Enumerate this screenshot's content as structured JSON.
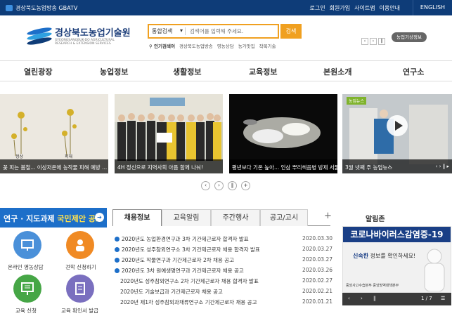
{
  "topbar": {
    "tv_label": "경상북도농업방송 GBATV",
    "links": [
      "로그인",
      "회원가입",
      "사이트맵",
      "이용안내"
    ],
    "lang": "ENGLISH"
  },
  "logo": {
    "name": "경상북도농업기술원",
    "sub_line1": "GYEONGSANGBUK-DO AGRICULTURAL",
    "sub_line2": "RESEARCH & EXTENSION SERVICES"
  },
  "search": {
    "scope": "통합검색",
    "placeholder": "검색어를 입력해 주세요.",
    "button": "검색"
  },
  "popular": {
    "label": "인기검색어",
    "terms": [
      "경상북도농업방송",
      "영농상담",
      "농가맛집",
      "작목기술"
    ]
  },
  "weather_button": "농업기상정보",
  "gnb": [
    "열린광장",
    "농업정보",
    "생활정보",
    "교육정보",
    "본원소개",
    "연구소"
  ],
  "slides": [
    {
      "caption": "꽃 피는 봄철... 이상저온에 농작물 피해 예방 ...",
      "art": "정상",
      "art2": "피해"
    },
    {
      "caption": "4H 정신으로 지역사회 아픔 함께 나눠!"
    },
    {
      "caption": "평년보다 기온 높아... 인삼 뿌리썩음병 방제 서둘..."
    },
    {
      "tag": "농업뉴스",
      "caption": "3월 넷째 주 농업뉴스"
    }
  ],
  "colors": {
    "navy": "#0e3c78",
    "orange": "#f0a020",
    "blue": "#1d6fc9"
  },
  "banner": {
    "text1": "연구 · 지도과제 ",
    "text2": "국민제안 공모"
  },
  "quick": [
    {
      "label": "온라인 영농상담",
      "color": "#4a90d9",
      "icon": "monitor-icon"
    },
    {
      "label": "견학 신청하기",
      "color": "#f08a24",
      "icon": "person-icon"
    },
    {
      "label": "교육 신청",
      "color": "#46a646",
      "icon": "presentation-icon"
    },
    {
      "label": "교육 확인서 발급",
      "color": "#7a6fbf",
      "icon": "document-icon"
    }
  ],
  "tabs": [
    "채용정보",
    "교육알림",
    "주간행사",
    "공고/고시"
  ],
  "news": [
    {
      "title": "2020년도 농업환경연구과 3차 기간제근로자 합격자 발표",
      "date": "2020.03.30",
      "bullet": true
    },
    {
      "title": "2020년도 성주참외연구소 3차 기간제근로자 채용 합격자 발표",
      "date": "2020.03.27",
      "bullet": true
    },
    {
      "title": "2020년도 작물연구과 기간제근로자 2차 채용 공고",
      "date": "2020.03.27",
      "bullet": true
    },
    {
      "title": "2020년도 3차 원예생명연구과 기간제근로자 채용 공고",
      "date": "2020.03.26",
      "bullet": true
    },
    {
      "title": "2020년도 성주참외연구소 2차 기간제근로자 채용 합격자 발표",
      "date": "2020.02.27",
      "bullet": false
    },
    {
      "title": "2020년도 기술보급과 기간제근로자 채용 공고",
      "date": "2020.02.21",
      "bullet": false
    },
    {
      "title": "2020년 제1차 성주참외과채류연구소 기간제근로자 채용 공고",
      "date": "2020.01.21",
      "bullet": false
    }
  ],
  "alert": {
    "title": "알림존",
    "headline": "코로나바이러스감염증-19",
    "sub1": "신속한",
    "sub2": " 정보를 확인하세요!",
    "org1": "중앙사고수습본부",
    "org2": "중앙방역대책본부",
    "page": "1 / 7"
  }
}
